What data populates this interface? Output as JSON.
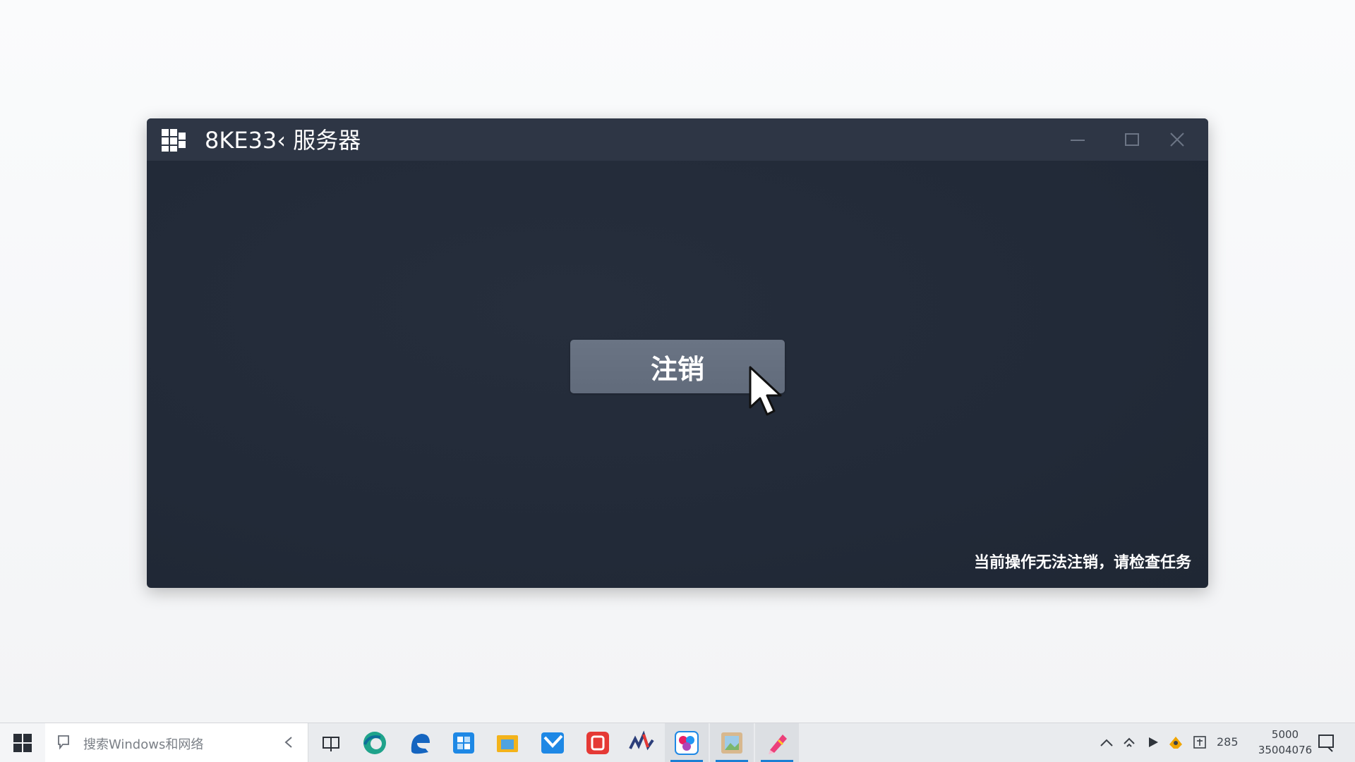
{
  "window": {
    "title": "8KE33‹ 服务器",
    "logout_label": "注销",
    "status_message": "当前操作无法注销，请检查任务"
  },
  "taskbar": {
    "search_placeholder": "搜索Windows和网络",
    "apps": [
      {
        "name": "task-view",
        "color": "#2b2f36"
      },
      {
        "name": "edge",
        "color": "#1fa38b"
      },
      {
        "name": "browser-blue",
        "color": "#1565c0"
      },
      {
        "name": "store",
        "color": "#1e88e5"
      },
      {
        "name": "file-explorer",
        "color": "#f3b31b"
      },
      {
        "name": "mail",
        "color": "#2196f3"
      },
      {
        "name": "red-app",
        "color": "#e53935"
      },
      {
        "name": "music-app",
        "color": "#2c3e7a"
      },
      {
        "name": "colorful-app",
        "color": "#e91e63"
      },
      {
        "name": "image-app",
        "color": "#c89c6a"
      },
      {
        "name": "pencil-app",
        "color": "#ec407a"
      }
    ],
    "tray_text": "285",
    "clock_time": "5000",
    "clock_date": "35004076"
  },
  "colors": {
    "window_bg": "#222a38",
    "titlebar_bg": "#2e3645",
    "button_bg": "#666f7f",
    "taskbar_bg": "#e9ebee",
    "accent": "#1a7fd4"
  }
}
